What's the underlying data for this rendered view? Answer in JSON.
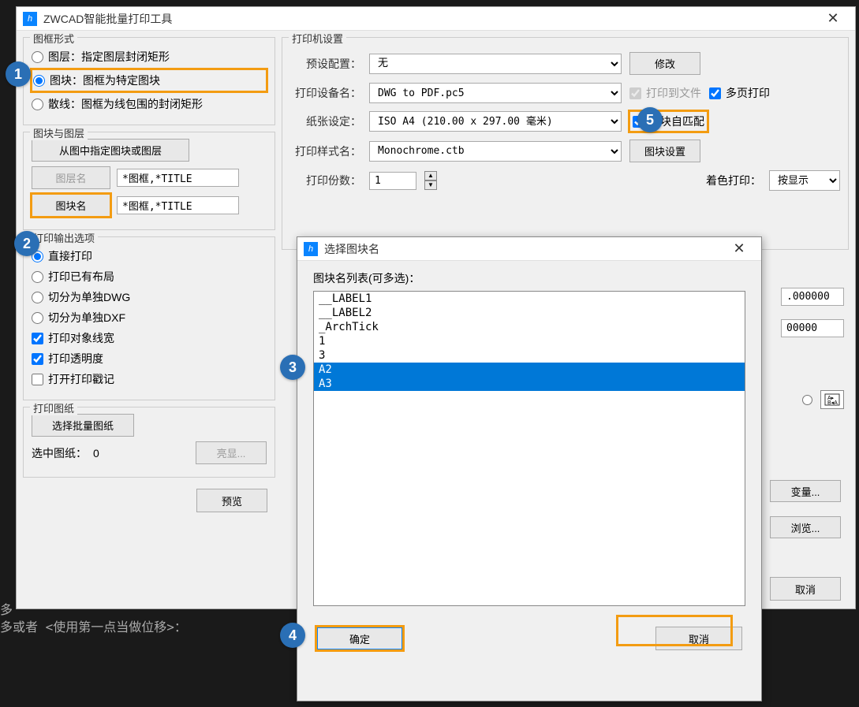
{
  "main_dialog": {
    "title": "ZWCAD智能批量打印工具",
    "frame_style": {
      "legend": "图框形式",
      "layer_label": "图层：指定图层封闭矩形",
      "block_label": "图块：图框为特定图块",
      "scatter_label": "散线：图框为线包围的封闭矩形"
    },
    "block_layer": {
      "legend": "图块与图层",
      "specify_btn": "从图中指定图块或图层",
      "layer_name_btn": "图层名",
      "layer_name_value": "*图框,*TITLE",
      "block_name_btn": "图块名",
      "block_name_value": "*图框,*TITLE"
    },
    "output_options": {
      "legend": "打印输出选项",
      "direct_print": "直接打印",
      "print_layout": "打印已有布局",
      "split_dwg": "切分为单独DWG",
      "split_dxf": "切分为单独DXF",
      "print_lineweight": "打印对象线宽",
      "print_transparency": "打印透明度",
      "open_stamp": "打开打印戳记"
    },
    "print_drawing": {
      "legend": "打印图纸",
      "select_btn": "选择批量图纸",
      "selected_label": "选中图纸：",
      "selected_count": "0",
      "highlight_btn": "亮显..."
    },
    "preview_btn": "预览",
    "printer_settings": {
      "legend": "打印机设置",
      "preset_label": "预设配置：",
      "preset_value": "无",
      "modify_btn": "修改",
      "device_label": "打印设备名：",
      "device_value": "DWG to PDF.pc5",
      "print_to_file": "打印到文件",
      "multipage": "多页打印",
      "paper_label": "纸张设定：",
      "paper_value": "ISO A4 (210.00 x 297.00 毫米)",
      "block_automatch": "图块自匹配",
      "style_label": "打印样式名：",
      "style_value": "Monochrome.ctb",
      "block_settings_btn": "图块设置",
      "copies_label": "打印份数：",
      "copies_value": "1",
      "shade_label": "着色打印：",
      "shade_value": "按显示"
    },
    "right_values": {
      "val1": ".000000",
      "val2": "00000"
    },
    "variables_btn": "变量...",
    "browse_btn": "浏览...",
    "cancel_btn": "取消"
  },
  "sub_dialog": {
    "title": "选择图块名",
    "list_label": "图块名列表(可多选)：",
    "items": [
      "__LABEL1",
      "__LABEL2",
      "_ArchTick",
      "1",
      "3",
      "A2",
      "A3"
    ],
    "ok_btn": "确定",
    "cancel_btn": "取消"
  },
  "bg": {
    "line1": "多",
    "line2": "多或者 <使用第一点当做位移>："
  },
  "steps": {
    "s1": "1",
    "s2": "2",
    "s3": "3",
    "s4": "4",
    "s5": "5"
  }
}
